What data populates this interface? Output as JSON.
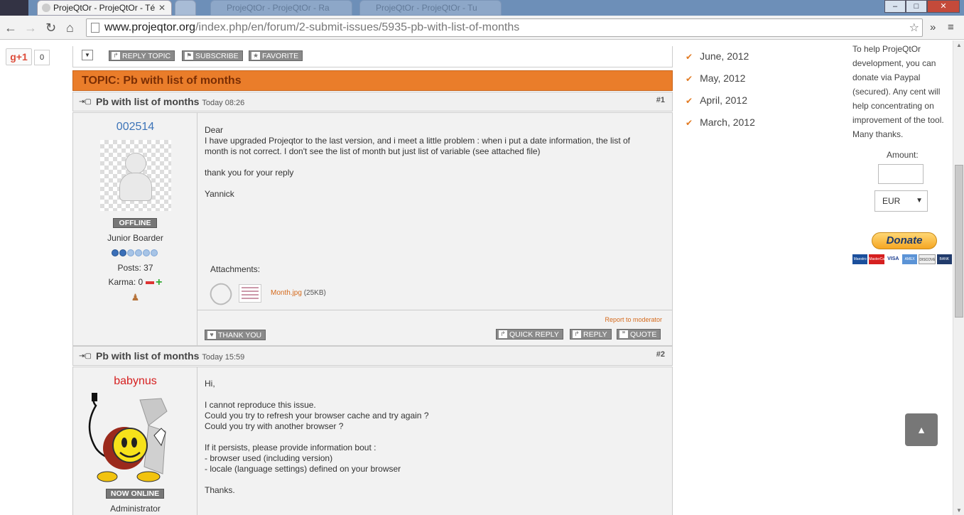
{
  "browser": {
    "active_tab": "ProjeQtOr - ProjeQtOr - Té",
    "inactive_tabs": [
      "ProjeQtOr - ProjeQtOr - Ra",
      "ProjeQtOr - ProjeQtOr - Tu"
    ],
    "url_host": "www.projeqtor.org",
    "url_path": "/index.php/en/forum/2-submit-issues/5935-pb-with-list-of-months",
    "win_min": "–",
    "win_max": "□",
    "win_close": "✕"
  },
  "social": {
    "gplus_label": "g+1",
    "gplus_count": "0"
  },
  "forum_toolbar": {
    "reply_topic": "REPLY TOPIC",
    "subscribe": "SUBSCRIBE",
    "favorite": "FAVORITE"
  },
  "topic_title": "TOPIC: Pb with list of months",
  "posts": [
    {
      "title": "Pb with list of months",
      "time": "Today 08:26",
      "number": "#1",
      "username": "002514",
      "status": "OFFLINE",
      "rank": "Junior Boarder",
      "posts": "Posts: 37",
      "karma": "Karma: 0",
      "message": [
        "Dear",
        "I have upgraded Projeqtor to the last version, and i meet a little problem : when i put a date information, the list of",
        "month is not correct. I don't see the list of month but just list of variable (see attached file)",
        "",
        "thank you for your reply",
        "",
        "Yannick"
      ],
      "attachments_label": "Attachments:",
      "attachment_name": "Month.jpg",
      "attachment_size": "(25KB)",
      "report": "Report to moderator",
      "thank_you": "THANK YOU",
      "quick_reply": "QUICK REPLY",
      "reply": "REPLY",
      "quote": "QUOTE"
    },
    {
      "title": "Pb with list of months",
      "time": "Today 15:59",
      "number": "#2",
      "username": "babynus",
      "status": "NOW ONLINE",
      "rank": "Administrator",
      "message": [
        "Hi,",
        "",
        "I cannot reproduce this issue.",
        "Could you try to refresh your browser cache and try again ?",
        "Could you try with another browser ?",
        "",
        "If it persists, please provide information bout :",
        "- browser used (including version)",
        "- locale (language settings) defined on your browser",
        "",
        "Thanks."
      ]
    }
  ],
  "archive": [
    "June, 2012",
    "May, 2012",
    "April, 2012",
    "March, 2012"
  ],
  "donate": {
    "text": [
      "To help ProjeQtOr",
      "development, you can",
      "donate via Paypal",
      "(secured). Any cent will",
      "help concentrating on",
      "improvement of the tool.",
      "Many thanks."
    ],
    "amount_label": "Amount:",
    "amount_value": "",
    "currency": "EUR",
    "button": "Donate",
    "cards": [
      "Maestro",
      "MasterCard",
      "VISA",
      "AMEX",
      "DISCOVER",
      "BANK"
    ]
  },
  "colors": {
    "accent": "#ea7d2a",
    "username1": "#3d74b8",
    "username2": "#d62020",
    "link": "#d56a1c"
  }
}
